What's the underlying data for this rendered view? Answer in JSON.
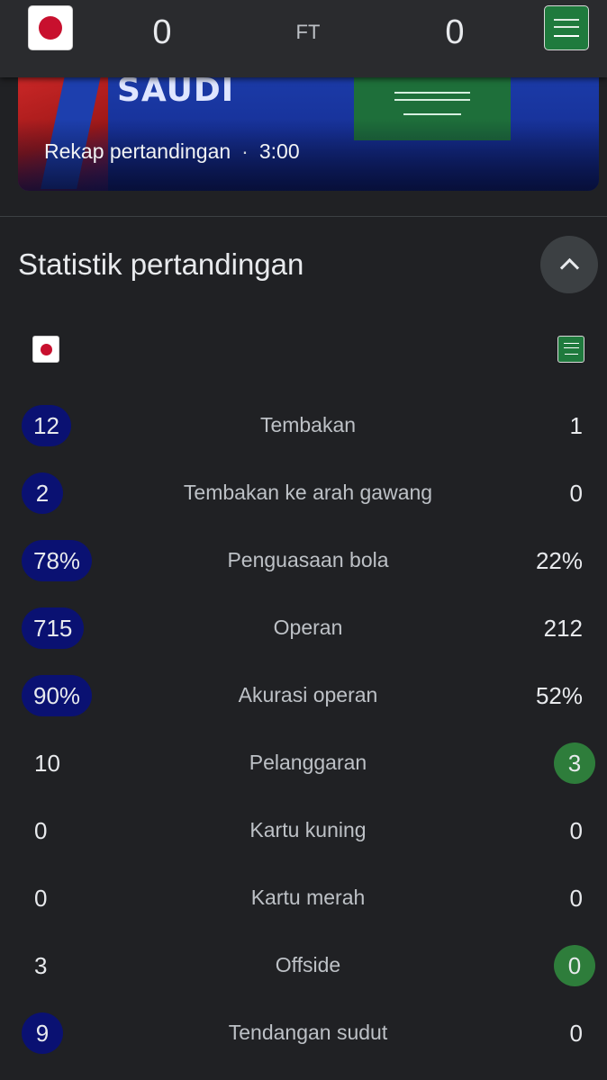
{
  "header": {
    "home_flag": "japan-flag",
    "away_flag": "saudi-arabia-flag",
    "home_score": "0",
    "away_score": "0",
    "status": "FT"
  },
  "recap": {
    "banner_text": "SAUDI ARABIA",
    "label": "Rekap pertandingan",
    "separator": "·",
    "duration": "3:00"
  },
  "stats": {
    "title": "Statistik pertandingan",
    "collapse_icon": "chevron-up-icon",
    "colors": {
      "home_highlight": "#0a1172",
      "away_highlight": "#2e7d3b"
    },
    "rows": [
      {
        "label": "Tembakan",
        "home": "12",
        "away": "1",
        "leader": "home"
      },
      {
        "label": "Tembakan ke arah gawang",
        "home": "2",
        "away": "0",
        "leader": "home"
      },
      {
        "label": "Penguasaan bola",
        "home": "78%",
        "away": "22%",
        "leader": "home"
      },
      {
        "label": "Operan",
        "home": "715",
        "away": "212",
        "leader": "home"
      },
      {
        "label": "Akurasi operan",
        "home": "90%",
        "away": "52%",
        "leader": "home"
      },
      {
        "label": "Pelanggaran",
        "home": "10",
        "away": "3",
        "leader": "away"
      },
      {
        "label": "Kartu kuning",
        "home": "0",
        "away": "0",
        "leader": "none"
      },
      {
        "label": "Kartu merah",
        "home": "0",
        "away": "0",
        "leader": "none"
      },
      {
        "label": "Offside",
        "home": "3",
        "away": "0",
        "leader": "away"
      },
      {
        "label": "Tendangan sudut",
        "home": "9",
        "away": "0",
        "leader": "home"
      }
    ]
  }
}
